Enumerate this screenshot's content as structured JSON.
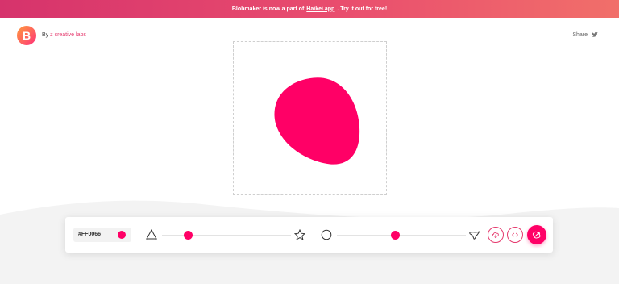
{
  "banner": {
    "prefix": "Blobmaker is now a part of",
    "link": "Haikei.app",
    "suffix": ". Try it out for free!"
  },
  "header": {
    "logo_letter": "B",
    "by_prefix": "By",
    "by_brand": "z creative labs",
    "share_label": "Share",
    "share_icon": "twitter-icon"
  },
  "blob": {
    "color": "#FF0066"
  },
  "toolbar": {
    "color_value": "#FF0066",
    "complexity": {
      "min_icon": "triangle-outline-icon",
      "max_icon": "star-outline-icon",
      "value": 0.2
    },
    "contrast": {
      "min_icon": "circle-outline-icon",
      "max_icon": "splat-outline-icon",
      "value": 0.45
    },
    "actions": [
      "download-icon",
      "code-icon",
      "random-generate-icon"
    ]
  },
  "colors": {
    "accent": "#FF0066",
    "brand_pink": "#E5396D",
    "track": "#E3E3E3",
    "wave_gray": "#F3F3F3"
  }
}
